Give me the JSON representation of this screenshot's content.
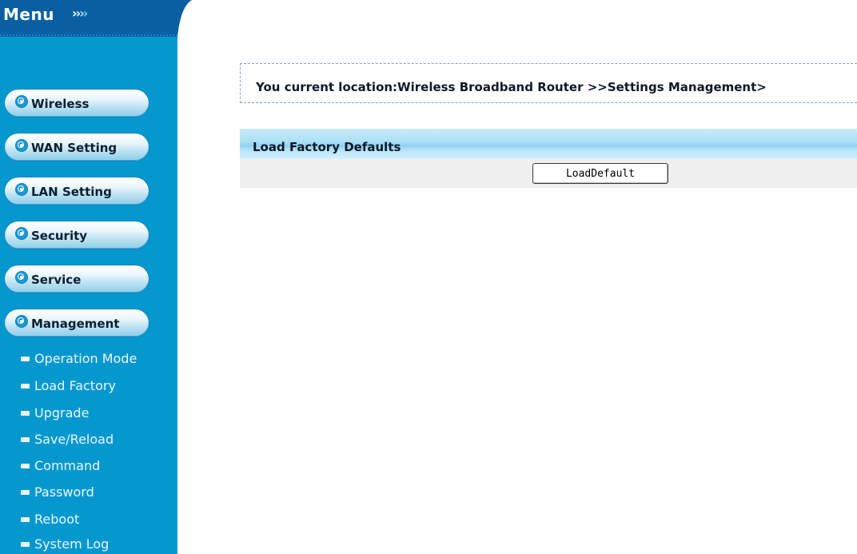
{
  "sidebar": {
    "title": "Menu",
    "arrows": "››››",
    "nav": [
      {
        "label": "Wireless"
      },
      {
        "label": "WAN Setting"
      },
      {
        "label": "LAN Setting"
      },
      {
        "label": "Security"
      },
      {
        "label": "Service"
      },
      {
        "label": "Management"
      }
    ],
    "management_items": [
      {
        "label": "Operation Mode"
      },
      {
        "label": "Load Factory"
      },
      {
        "label": "Upgrade"
      },
      {
        "label": "Save/Reload"
      },
      {
        "label": "Command"
      },
      {
        "label": "Password"
      },
      {
        "label": "Reboot"
      },
      {
        "label": "System Log"
      }
    ]
  },
  "main": {
    "breadcrumb": "You current location:Wireless Broadband Router >>Settings Management>",
    "section_title": "Load Factory Defaults",
    "button_label": "LoadDefault"
  },
  "colors": {
    "sidebar_bg": "#0598cf",
    "header_bg": "#0a5fa3",
    "section_header": "#a9dff6",
    "row_bg": "#efefef"
  }
}
